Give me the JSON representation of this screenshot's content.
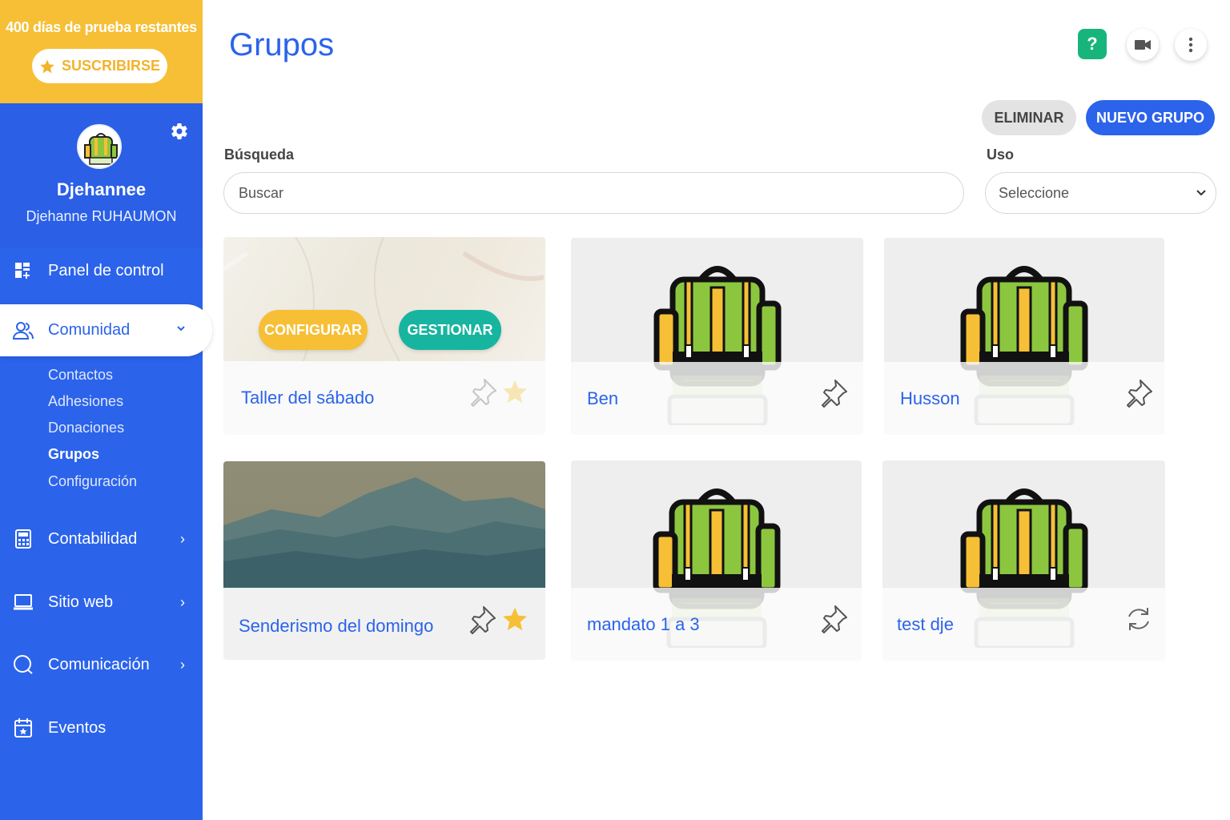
{
  "trial": {
    "message": "400 días de prueba restantes",
    "subscribe_label": "SUSCRIBIRSE"
  },
  "profile": {
    "name": "Djehannee",
    "full_name": "Djehanne RUHAUMON"
  },
  "nav": {
    "panel": "Panel de control",
    "comunidad": "Comunidad",
    "sub": [
      "Contactos",
      "Adhesiones",
      "Donaciones",
      "Grupos",
      "Configuración"
    ],
    "contabilidad": "Contabilidad",
    "sitio_web": "Sitio web",
    "comunicacion": "Comunicación",
    "eventos": "Eventos"
  },
  "header": {
    "title": "Grupos",
    "help": "?"
  },
  "actions": {
    "eliminar": "ELIMINAR",
    "nuevo": "NUEVO GRUPO"
  },
  "filters": {
    "search_label": "Búsqueda",
    "search_placeholder": "Buscar",
    "uso_label": "Uso",
    "uso_value": "Seleccione"
  },
  "groups": [
    {
      "title": "Taller del sábado",
      "configurar": "CONFIGURAR",
      "gestionar": "GESTIONAR",
      "starred": true
    },
    {
      "title": "Ben"
    },
    {
      "title": "Husson"
    },
    {
      "title": "Senderismo del domingo",
      "starred": true
    },
    {
      "title": "mandato 1 a 3"
    },
    {
      "title": "test dje"
    }
  ],
  "colors": {
    "primary": "#2b63eb",
    "accent_yellow": "#f6bf35",
    "teal": "#17b57c"
  }
}
